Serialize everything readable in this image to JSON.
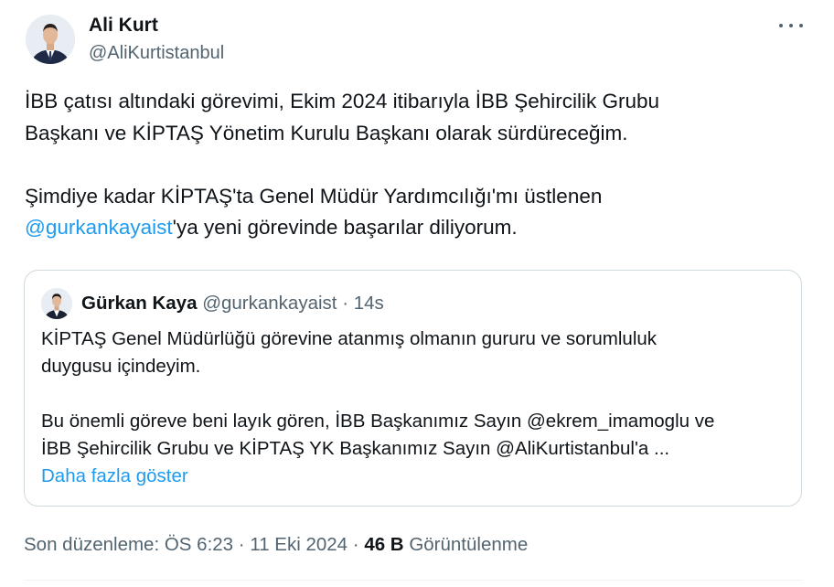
{
  "author": {
    "name": "Ali Kurt",
    "handle": "@AliKurtistanbul"
  },
  "icons": {
    "more": "more-horizontal-icon",
    "avatar": "avatar"
  },
  "tweet": {
    "line1": "İBB çatısı altındaki görevimi, Ekim 2024 itibarıyla İBB Şehircilik Grubu",
    "line2": "Başkanı ve KİPTAŞ Yönetim Kurulu Başkanı olarak sürdüreceğim.",
    "line3": "Şimdiye kadar KİPTAŞ'ta Genel Müdür Yardımcılığı'mı üstlenen",
    "mention": "@gurkankayaist",
    "line4_rest": "'ya yeni görevinde başarılar diliyorum."
  },
  "quote": {
    "name": "Gürkan Kaya",
    "handle": "@gurkankayaist",
    "separator": "·",
    "time": "14s",
    "line1": "KİPTAŞ Genel Müdürlüğü görevine atanmış olmanın gururu ve sorumluluk",
    "line2": "duygusu içindeyim.",
    "line3": "Bu önemli göreve beni layık gören, İBB Başkanımız Sayın @ekrem_imamoglu ve",
    "line4": "İBB Şehircilik Grubu ve KİPTAŞ YK Başkanımız Sayın @AliKurtistanbul'a ...",
    "show_more": "Daha fazla göster"
  },
  "meta": {
    "edited_label": "Son düzenleme:",
    "time": "ÖS 6:23",
    "sep1": "·",
    "date": "11 Eki 2024",
    "sep2": "·",
    "views_count": "46 B",
    "views_label": "Görüntülenme"
  },
  "colors": {
    "accent": "#1d9bf0",
    "text": "#0f1419",
    "secondary": "#536471",
    "border": "#cfd9de"
  }
}
